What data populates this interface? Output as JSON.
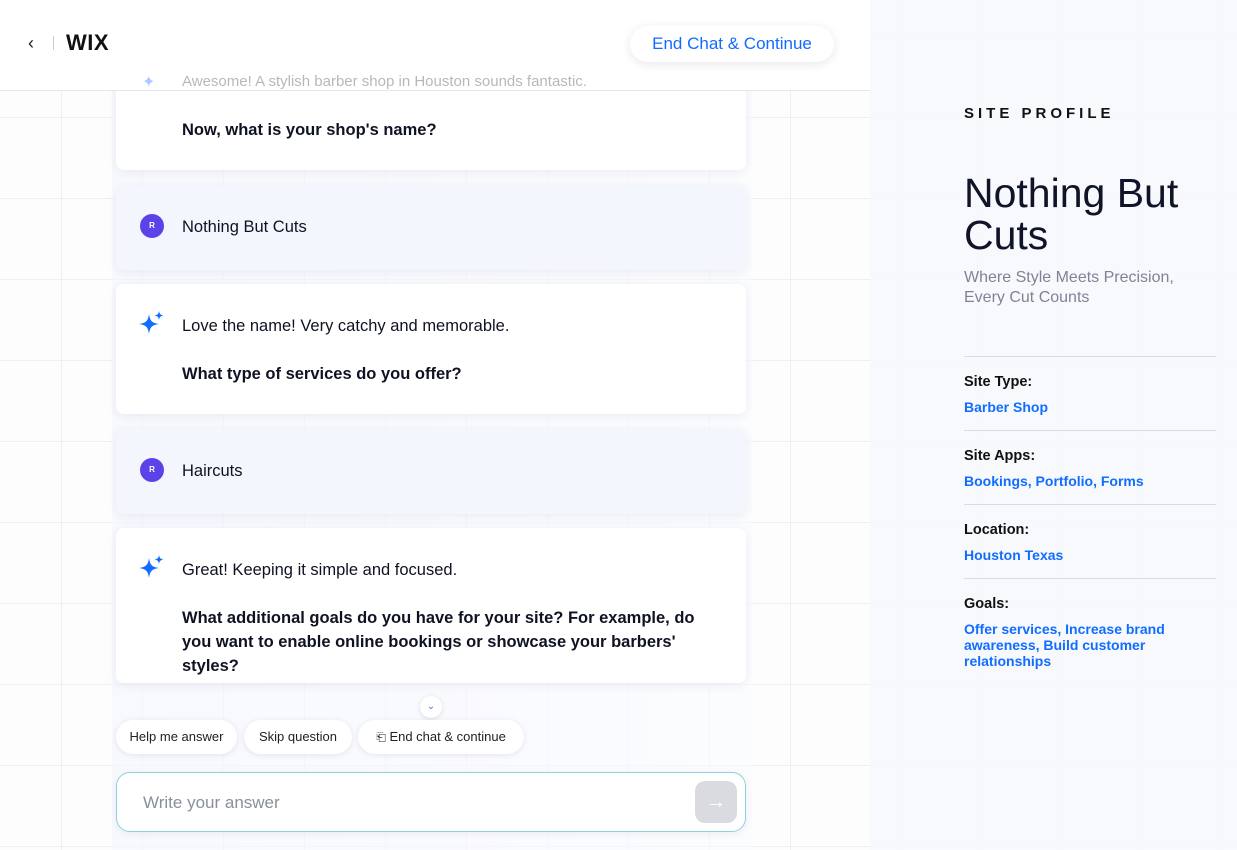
{
  "header": {
    "back_icon": "chevron-left-icon",
    "logo": "WIX",
    "end_chat_label": "End Chat & Continue"
  },
  "chat": {
    "faded_text": "Awesome! A stylish barber shop in Houston sounds fantastic.",
    "messages": [
      {
        "role": "ai",
        "lines": [],
        "question": "Now, what is your shop's name?"
      },
      {
        "role": "user",
        "avatar": "R",
        "text": "Nothing But Cuts"
      },
      {
        "role": "ai",
        "text": "Love the name! Very catchy and memorable.",
        "question": "What type of services do you offer?"
      },
      {
        "role": "user",
        "avatar": "R",
        "text": "Haircuts"
      },
      {
        "role": "ai",
        "text": "Great! Keeping it simple and focused.",
        "question": "What additional goals do you have for your site? For example, do you want to enable online bookings or showcase your barbers' styles?"
      }
    ],
    "chips": {
      "help": "Help me answer",
      "skip": "Skip question",
      "end": "End chat & continue"
    },
    "input": {
      "placeholder": "Write your answer",
      "value": ""
    }
  },
  "profile": {
    "section_label": "SITE PROFILE",
    "site_name": "Nothing But Cuts",
    "tagline": "Where Style Meets Precision, Every Cut Counts",
    "fields": [
      {
        "label": "Site Type:",
        "value": "Barber Shop"
      },
      {
        "label": "Site Apps:",
        "value": "Bookings, Portfolio, Forms"
      },
      {
        "label": "Location:",
        "value": "Houston Texas"
      },
      {
        "label": "Goals:",
        "value": "Offer services, Increase brand awareness, Build customer relationships"
      }
    ]
  },
  "colors": {
    "accent": "#116dff",
    "avatar": "#5b43e8",
    "user_bubble": "#f3f6fd"
  }
}
